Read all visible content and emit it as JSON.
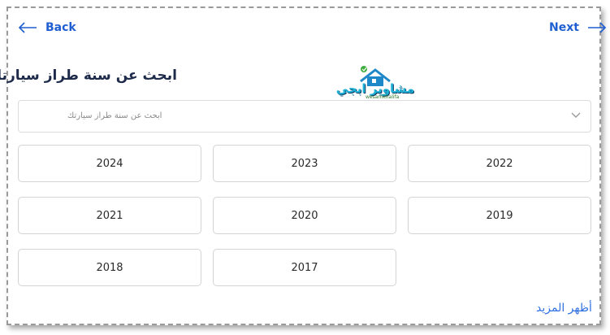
{
  "nav": {
    "back_label": "Back",
    "next_label": "Next"
  },
  "heading": "ابحث عن سنة طراز سيارتك",
  "logo": {
    "brand": "مشاوير ابجي",
    "sub": "wesamkhalifa"
  },
  "search": {
    "placeholder": "ابحث عن سنة طراز سيارتك"
  },
  "years": [
    "2024",
    "2023",
    "2022",
    "2021",
    "2020",
    "2019",
    "2018",
    "2017"
  ],
  "show_more": "أظهر المزيد",
  "colors": {
    "accent": "#1f5fd1",
    "heading": "#1d2a4a",
    "border": "#d4d4d4"
  }
}
